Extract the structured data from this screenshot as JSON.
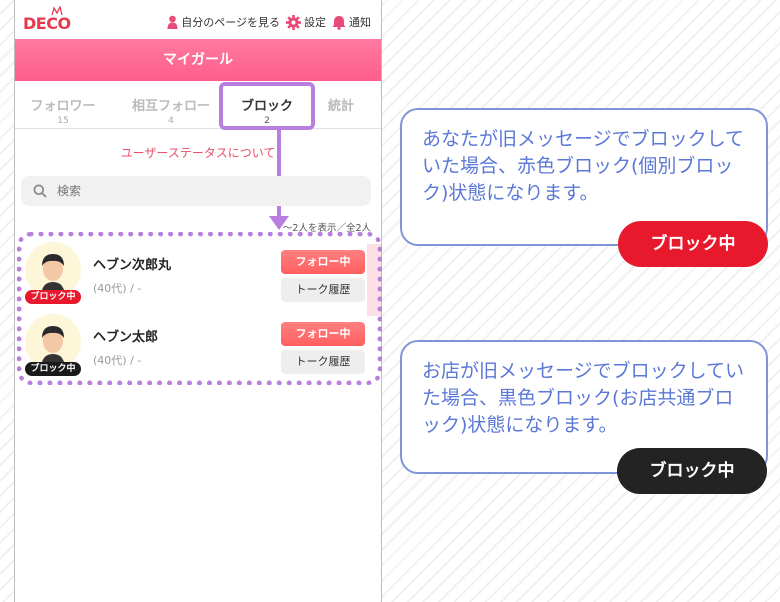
{
  "app": {
    "logo": "DECO",
    "header_title": "マイガール",
    "nav": {
      "mypage": "自分のページを見る",
      "settings": "設定",
      "notifications": "通知"
    }
  },
  "tabs": [
    {
      "label": "フォロワー",
      "count": "15"
    },
    {
      "label": "相互フォロー",
      "count": "4"
    },
    {
      "label": "ブロック",
      "count": "2"
    },
    {
      "label": "統計",
      "count": ""
    }
  ],
  "status_link": "ユーザーステータスについて",
  "search": {
    "placeholder": "検索"
  },
  "result_count": "～2人を表示／全2人",
  "users": [
    {
      "name": "ヘブン次郎丸",
      "meta": "(40代) / -",
      "badge": "ブロック中",
      "badge_color": "#e8192c",
      "follow_label": "フォロー中",
      "talk_label": "トーク履歴"
    },
    {
      "name": "ヘブン太郎",
      "meta": "(40代) / -",
      "badge": "ブロック中",
      "badge_color": "#1a1a1a",
      "follow_label": "フォロー中",
      "talk_label": "トーク履歴"
    }
  ],
  "callouts": [
    {
      "text": "あなたが旧メッセージでブロックしていた場合、赤色ブロック(個別ブロック)状態になります。",
      "pill": "ブロック中",
      "pill_color": "#e8192c"
    },
    {
      "text": "お店が旧メッセージでブロックしていた場合、黒色ブロック(お店共通ブロック)状態になります。",
      "pill": "ブロック中",
      "pill_color": "#232323"
    }
  ],
  "colors": {
    "accent": "#ff5e8b",
    "highlight": "#b97fe0",
    "callout_border": "#7f95d9",
    "callout_text": "#5b78d6"
  }
}
